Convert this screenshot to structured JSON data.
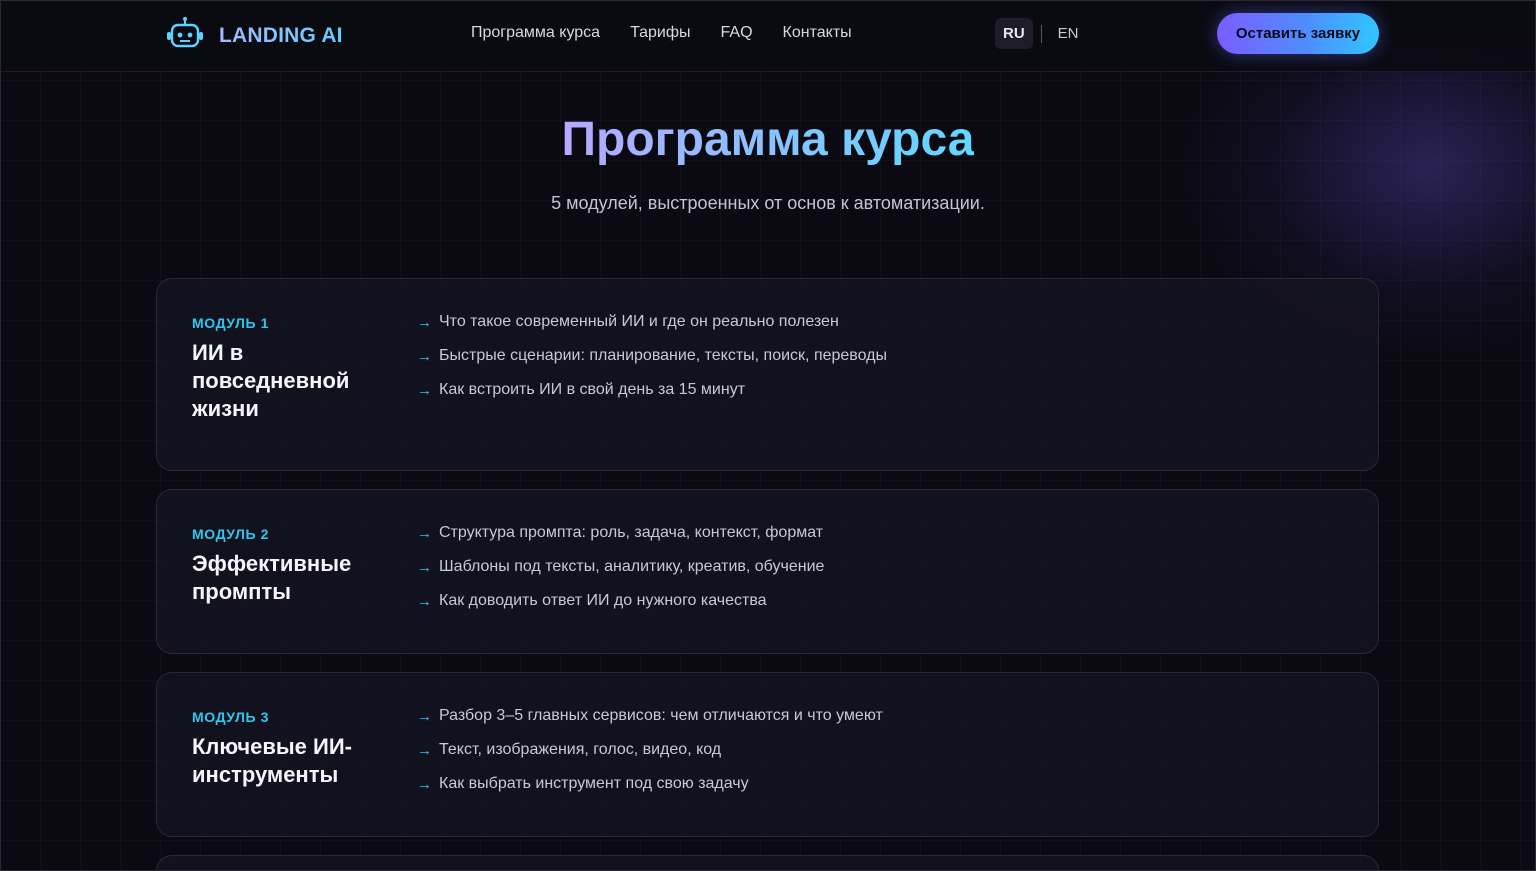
{
  "header": {
    "logo_text": "LANDING AI",
    "nav": [
      "Программа курса",
      "Тарифы",
      "FAQ",
      "Контакты"
    ],
    "lang_active": "RU",
    "lang_other": "EN",
    "cta_label": "Оставить заявку"
  },
  "hero": {
    "title": "Программа курса",
    "subtitle": "5 модулей, выстроенных от основ к автоматизации."
  },
  "modules": [
    {
      "label": "МОДУЛЬ 1",
      "title": "ИИ в повседневной жизни",
      "items": [
        "Что такое современный ИИ и где он реально полезен",
        "Быстрые сценарии: планирование, тексты, поиск, переводы",
        "Как встроить ИИ в свой день за 15 минут"
      ]
    },
    {
      "label": "МОДУЛЬ 2",
      "title": "Эффективные промпты",
      "items": [
        "Структура промпта: роль, задача, контекст, формат",
        "Шаблоны под тексты, аналитику, креатив, обучение",
        "Как доводить ответ ИИ до нужного качества"
      ]
    },
    {
      "label": "МОДУЛЬ 3",
      "title": "Ключевые ИИ-инструменты",
      "items": [
        "Разбор 3–5 главных сервисов: чем отличаются и что умеют",
        "Текст, изображения, голос, видео, код",
        "Как выбрать инструмент под свою задачу"
      ]
    }
  ],
  "icons": {
    "logo": "robot-icon",
    "item_bullet": "arrow-right-icon"
  },
  "colors": {
    "accent": "#2fc7ee",
    "background": "#0b0a12",
    "card": "#14131f"
  }
}
